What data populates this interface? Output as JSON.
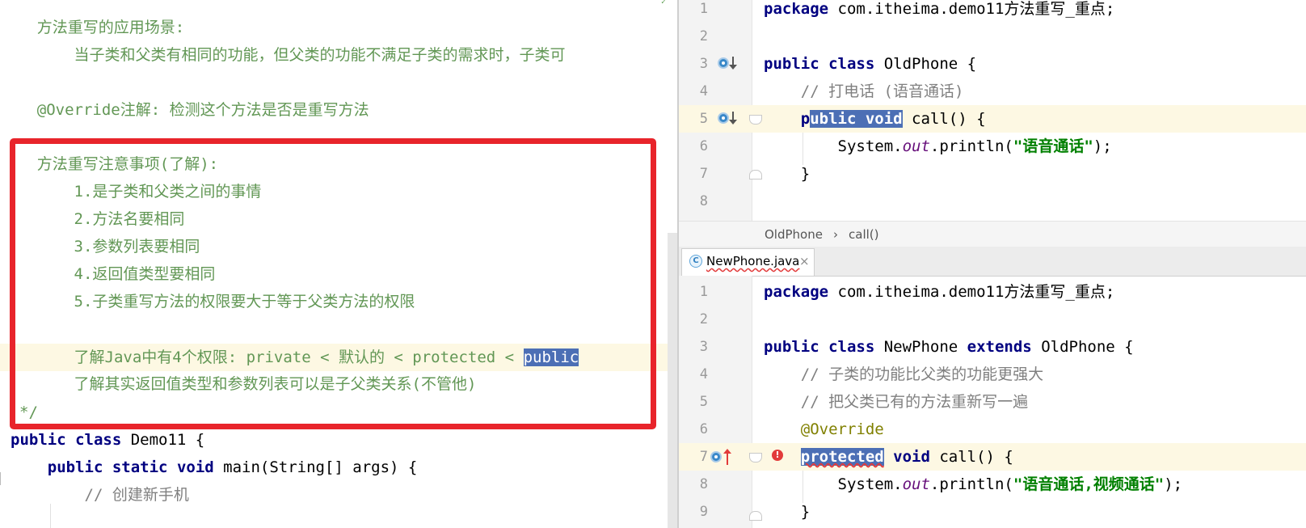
{
  "left_editor": {
    "lines": [
      {
        "indent": "    ",
        "text": "方法重写的应用场景:"
      },
      {
        "indent": "        ",
        "text": "当子类和父类有相同的功能，但父类的功能不满足子类的需求时，子类可"
      },
      {
        "indent": "",
        "text": ""
      },
      {
        "indent": "    ",
        "text": "@Override注解: 检测这个方法是否是重写方法"
      },
      {
        "indent": "",
        "text": ""
      },
      {
        "indent": "    ",
        "text": "方法重写注意事项(了解):"
      },
      {
        "indent": "        ",
        "text": "1.是子类和父类之间的事情"
      },
      {
        "indent": "        ",
        "text": "2.方法名要相同"
      },
      {
        "indent": "        ",
        "text": "3.参数列表要相同"
      },
      {
        "indent": "        ",
        "text": "4.返回值类型要相同"
      },
      {
        "indent": "        ",
        "text": "5.子类重写方法的权限要大于等于父类方法的权限"
      },
      {
        "indent": "",
        "text": ""
      }
    ],
    "access_line": {
      "indent": "        ",
      "text": "了解Java中有4个权限: private < 默认的 < protected < ",
      "selected": "public"
    },
    "return_line": {
      "indent": "        ",
      "text": "了解其实返回值类型和参数列表可以是子父类关系(不管他)"
    },
    "comment_end": "*/",
    "class_decl": {
      "kw1": "public",
      "kw2": "class",
      "name": " Demo11 {"
    },
    "main_decl": {
      "indent": "    ",
      "kw1": "public",
      "kw2": "static",
      "kw3": "void",
      "rest": " main(String[] args) {"
    },
    "comment_new_phone": {
      "indent": "        ",
      "text": "// 创建新手机"
    }
  },
  "top_editor": {
    "file": "OldPhone",
    "lines": [
      {
        "num": "1",
        "kw": "package",
        "rest": " com.itheima.demo11方法重写_重点;"
      },
      {
        "num": "2"
      },
      {
        "num": "3",
        "kw": "public class",
        "rest": " OldPhone {"
      },
      {
        "num": "4",
        "comment": "    // 打电话 (语音通话)"
      },
      {
        "num": "5",
        "indent": "    ",
        "sel_prefix": "p",
        "sel": "ublic void",
        "rest": " call() {"
      },
      {
        "num": "6",
        "indent": "        ",
        "pre": "System.",
        "field": "out",
        "mid": ".println(",
        "str": "\"语音通话\"",
        "end": ");"
      },
      {
        "num": "7",
        "text": "    }"
      },
      {
        "num": "8"
      }
    ]
  },
  "breadcrumb": {
    "class_name": "OldPhone",
    "method_name": "call()",
    "separator": "›"
  },
  "tab": {
    "label": "NewPhone.java",
    "icon_letter": "C",
    "close": "×"
  },
  "bottom_editor": {
    "lines": [
      {
        "num": "1",
        "kw": "package",
        "rest": " com.itheima.demo11方法重写_重点;"
      },
      {
        "num": "2"
      },
      {
        "num": "3",
        "kw": "public class",
        "rest1": " NewPhone ",
        "kw2": "extends",
        "rest2": " OldPhone {"
      },
      {
        "num": "4",
        "comment": "    // 子类的功能比父类的功能更强大"
      },
      {
        "num": "5",
        "comment": "    // 把父类已有的方法重新写一遍"
      },
      {
        "num": "6",
        "annotation": "    @Override"
      },
      {
        "num": "7",
        "indent": "    ",
        "sel": "protected",
        "kw": " void",
        "rest": " call() {"
      },
      {
        "num": "8",
        "indent": "        ",
        "pre": "System.",
        "field": "out",
        "mid": ".println(",
        "str": "\"语音通话,视频通话\"",
        "end": ");"
      },
      {
        "num": "9",
        "text": "    }"
      }
    ]
  },
  "colors": {
    "doc_comment": "#629755",
    "keyword": "#000080",
    "selection": "#4c6fb5",
    "highlight_line": "#fdf8e3",
    "red_box": "#e8242b",
    "annotation": "#808000"
  }
}
